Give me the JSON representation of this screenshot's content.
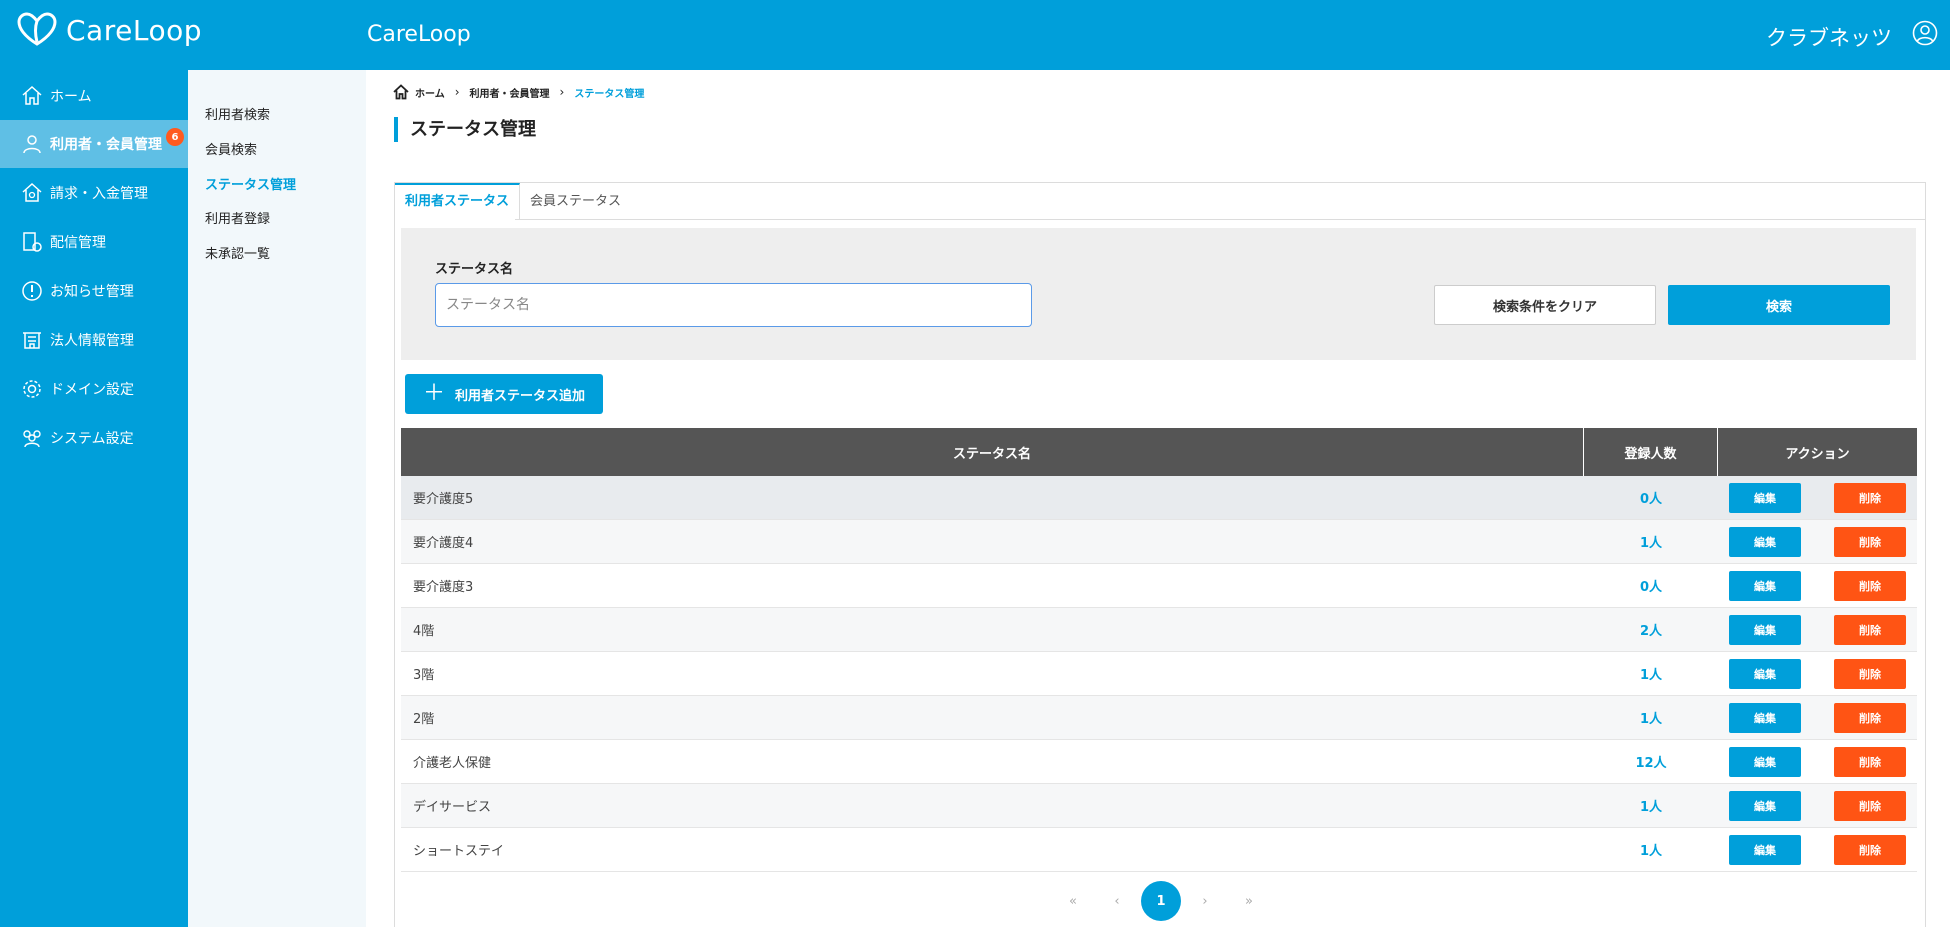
{
  "header": {
    "logo_text": "CareLoop",
    "title": "CareLoop",
    "user": "クラブネッツ"
  },
  "sidebar": {
    "items": [
      {
        "label": "ホーム",
        "icon": "home-icon"
      },
      {
        "label": "利用者・会員管理",
        "icon": "users-icon",
        "badge": "6"
      },
      {
        "label": "請求・入金管理",
        "icon": "billing-icon"
      },
      {
        "label": "配信管理",
        "icon": "delivery-icon"
      },
      {
        "label": "お知らせ管理",
        "icon": "notice-icon"
      },
      {
        "label": "法人情報管理",
        "icon": "building-icon"
      },
      {
        "label": "ドメイン設定",
        "icon": "gear-icon"
      },
      {
        "label": "システム設定",
        "icon": "group-icon"
      }
    ]
  },
  "subnav": {
    "items": [
      "利用者検索",
      "会員検索",
      "ステータス管理",
      "利用者登録",
      "未承認一覧"
    ],
    "active_index": 2
  },
  "breadcrumb": {
    "home": "ホーム",
    "parent": "利用者・会員管理",
    "current": "ステータス管理"
  },
  "page": {
    "title": "ステータス管理"
  },
  "tabs": [
    "利用者ステータス",
    "会員ステータス"
  ],
  "search": {
    "label": "ステータス名",
    "placeholder": "ステータス名",
    "value": "",
    "clear_label": "検索条件をクリア",
    "search_label": "検索"
  },
  "add_button": {
    "plus": "＋",
    "label": "利用者ステータス追加"
  },
  "table": {
    "headers": [
      "ステータス名",
      "登録人数",
      "アクション"
    ],
    "edit_label": "編集",
    "delete_label": "削除",
    "rows": [
      {
        "name": "要介護度5",
        "count": "0人"
      },
      {
        "name": "要介護度4",
        "count": "1人"
      },
      {
        "name": "要介護度3",
        "count": "0人"
      },
      {
        "name": "4階",
        "count": "2人"
      },
      {
        "name": "3階",
        "count": "1人"
      },
      {
        "name": "2階",
        "count": "1人"
      },
      {
        "name": "介護老人保健",
        "count": "12人"
      },
      {
        "name": "デイサービス",
        "count": "1人"
      },
      {
        "name": "ショートステイ",
        "count": "1人"
      }
    ]
  },
  "pagination": {
    "first": "«",
    "prev": "‹",
    "current": "1",
    "next": "›",
    "last": "»"
  },
  "colors": {
    "primary": "#009fda",
    "danger": "#ff5414",
    "header_bg": "#555555"
  }
}
